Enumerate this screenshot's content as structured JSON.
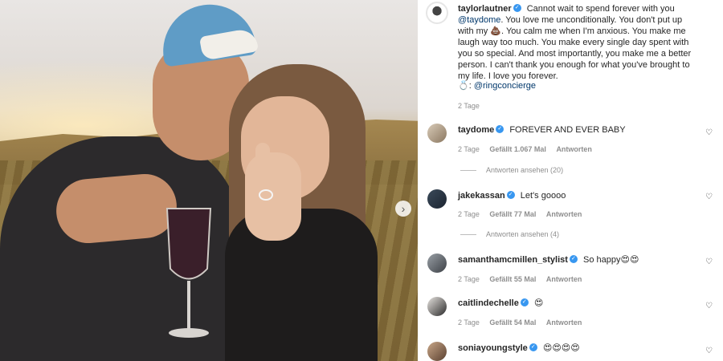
{
  "post": {
    "author": "taylorlautner",
    "caption_part1": "Cannot wait to spend forever with you",
    "caption_mention": "@taydome",
    "caption_part2": ". You love me unconditionally. You don't put up with my 💩. You calm me when I'm anxious. You make me laugh way too much. You make every single day spent with you so special. And most importantly, you make me a better person. I can't thank you enough for what you've brought to my life. I love you forever.",
    "ring_emoji": "💍",
    "ring_mention": "@ringconcierge",
    "time": "2 Tage"
  },
  "comments": [
    {
      "user": "taydome",
      "text": "FOREVER AND EVER BABY",
      "time": "2 Tage",
      "likes": "Gefällt 1.067 Mal",
      "reply": "Antworten",
      "view_replies": "Antworten ansehen (20)"
    },
    {
      "user": "jakekassan",
      "text": "Let's goooo",
      "time": "2 Tage",
      "likes": "Gefällt 77 Mal",
      "reply": "Antworten",
      "view_replies": "Antworten ansehen (4)"
    },
    {
      "user": "samanthamcmillen_stylist",
      "text": "So happy😍😍",
      "time": "2 Tage",
      "likes": "Gefällt 55 Mal",
      "reply": "Antworten"
    },
    {
      "user": "caitlindechelle",
      "text": "😍",
      "time": "2 Tage",
      "likes": "Gefällt 54 Mal",
      "reply": "Antworten"
    },
    {
      "user": "soniayoungstyle",
      "text": "😍😍😍😍"
    }
  ],
  "icons": {
    "verified": "✓",
    "heart": "♡",
    "next": "›"
  },
  "colors": {
    "link": "#00376b",
    "verified": "#3897f0",
    "meta": "#8e8e8e"
  }
}
